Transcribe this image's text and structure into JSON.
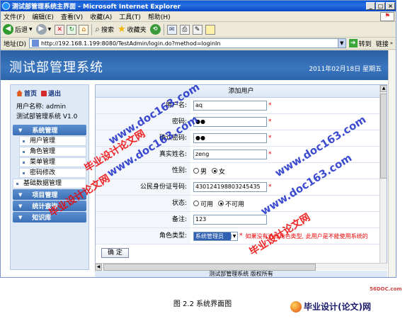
{
  "browser": {
    "title": "测试部管理系统主界面 - Microsoft Internet Explorer",
    "menu": [
      "文件(F)",
      "编辑(E)",
      "查看(V)",
      "收藏(A)",
      "工具(T)",
      "帮助(H)"
    ],
    "toolbar": {
      "back": "后退",
      "search": "搜索",
      "favorites": "收藏夹"
    },
    "address_label": "地址(D)",
    "url": "http://192.168.1.199:8080/TestAdmin/login.do?method=loginIn",
    "go_label": "转到",
    "links_label": "链接"
  },
  "app": {
    "system_name": "测试部管理系统",
    "date": "2011年02月18日  星期五",
    "nav": {
      "home": "首页",
      "logout": "退出"
    },
    "user_line": "用户名称: admin",
    "version_line": "测试部管理系统 V1.0",
    "menu": [
      {
        "label": "系统管理",
        "type": "head"
      },
      {
        "label": "用户管理",
        "type": "item"
      },
      {
        "label": "角色管理",
        "type": "item"
      },
      {
        "label": "菜单管理",
        "type": "item"
      },
      {
        "label": "密码修改",
        "type": "item"
      },
      {
        "label": "基础数据管理",
        "type": "item"
      },
      {
        "label": "项目管理",
        "type": "head"
      },
      {
        "label": "统计查询",
        "type": "head"
      },
      {
        "label": "知识库",
        "type": "head"
      }
    ],
    "form": {
      "title": "添加用户",
      "username_label": "用户名:",
      "username_value": "aq",
      "password_label": "密码:",
      "password_value": "●●",
      "confirm_label": "确认密码:",
      "confirm_value": "●●",
      "realname_label": "真实姓名:",
      "realname_value": "zeng",
      "gender_label": "性别:",
      "gender_male": "男",
      "gender_female": "女",
      "id_label": "公民身份证号码:",
      "id_value": "430124198803245435",
      "status_label": "状态:",
      "status_on": "可用",
      "status_off": "不可用",
      "remark_label": "备注:",
      "remark_value": "123",
      "role_label": "角色类型:",
      "role_value": "系统管理员",
      "role_hint": "如果没有选择角色类型, 此用户是不能使用系统的",
      "submit": "确  定",
      "required_mark": "*"
    },
    "footer": "测试部管理系统  版权所有"
  },
  "watermarks": {
    "doc163": "www.doc163.com",
    "bysj": "毕业设计论文网"
  },
  "caption": "图 2.2  系统界面图",
  "logos": {
    "site56": "56DOC.com",
    "bysj_brand": "毕业设计(论文)网"
  }
}
